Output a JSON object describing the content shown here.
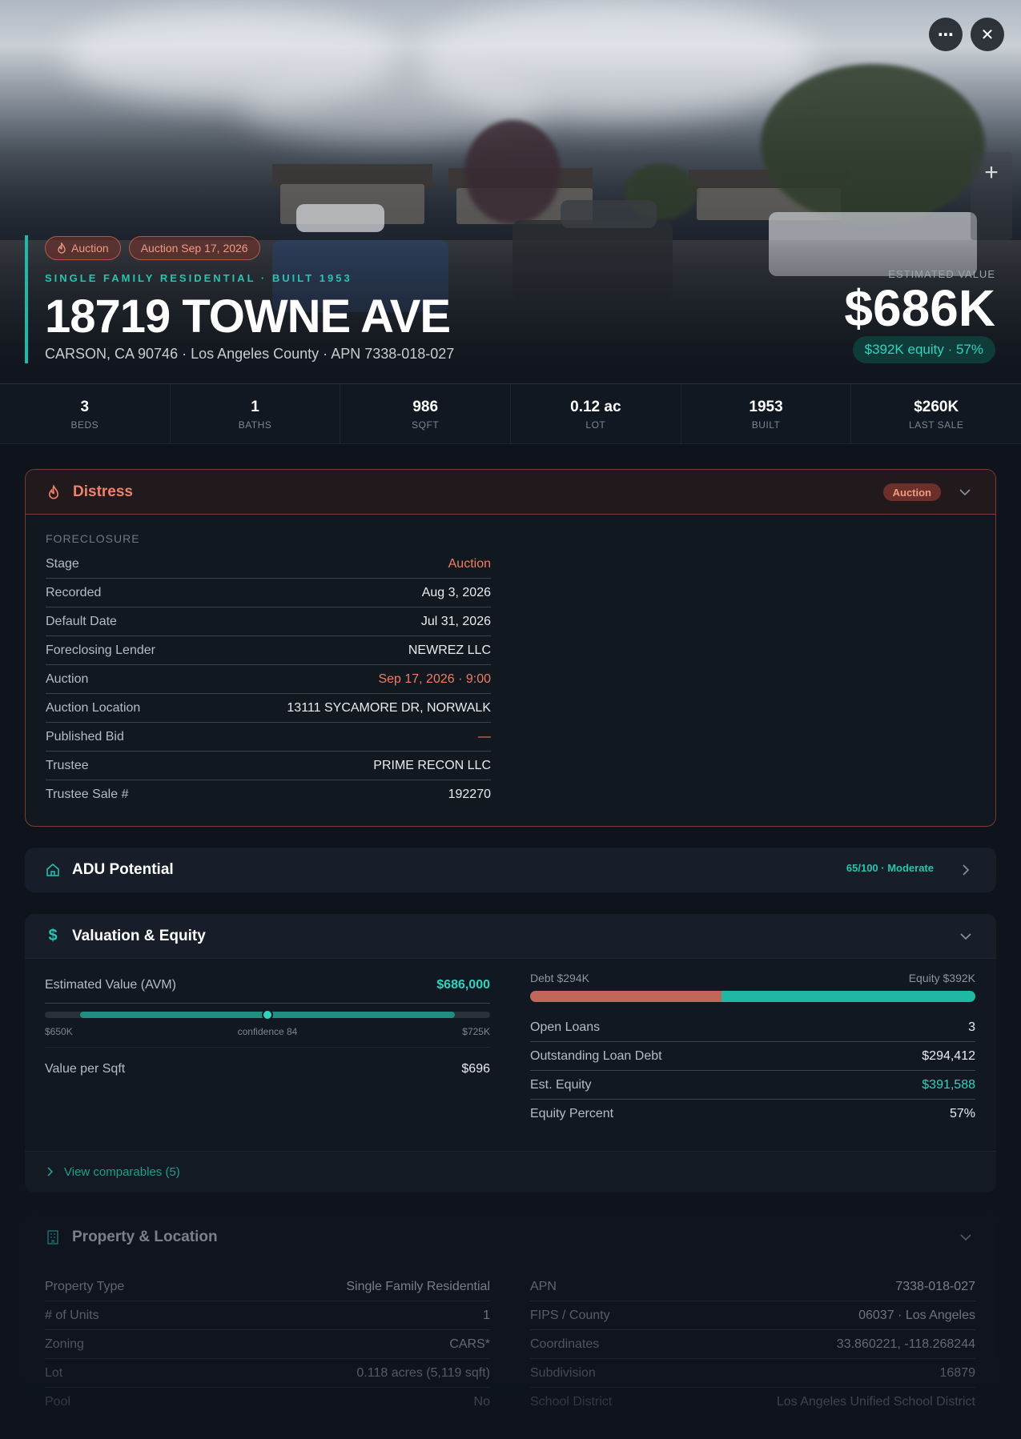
{
  "hero": {
    "tags": [
      "Auction",
      "Auction Sep 17, 2026"
    ],
    "kicker": "SINGLE FAMILY RESIDENTIAL · BUILT 1953",
    "address": "18719 TOWNE AVE",
    "subaddress": "CARSON, CA 90746 · Los Angeles County · APN 7338-018-027",
    "estimated_label": "ESTIMATED VALUE",
    "estimated_value": "$686K",
    "equity_pill": "$392K equity · 57%",
    "more_icon": "⋯",
    "close_icon": "✕",
    "zoom_icon": "+"
  },
  "stats": [
    {
      "value": "3",
      "label": "BEDS"
    },
    {
      "value": "1",
      "label": "BATHS"
    },
    {
      "value": "986",
      "label": "SQFT"
    },
    {
      "value": "0.12 ac",
      "label": "LOT"
    },
    {
      "value": "1953",
      "label": "BUILT"
    },
    {
      "value": "$260K",
      "label": "LAST SALE"
    }
  ],
  "distress": {
    "title": "Distress",
    "badge": "Auction",
    "section_label": "FORECLOSURE",
    "rows": [
      {
        "k": "Stage",
        "v": "Auction"
      },
      {
        "k": "Recorded",
        "v": "Aug 3, 2026"
      },
      {
        "k": "Default Date",
        "v": "Jul 31, 2026"
      },
      {
        "k": "Foreclosing Lender",
        "v": "NEWREZ LLC"
      },
      {
        "k": "Auction",
        "v": "Sep 17, 2026 · 9:00"
      },
      {
        "k": "Auction Location",
        "v": "13111 SYCAMORE DR, NORWALK"
      },
      {
        "k": "Published Bid",
        "v": "—"
      },
      {
        "k": "Trustee",
        "v": "PRIME RECON LLC"
      },
      {
        "k": "Trustee Sale #",
        "v": "192270"
      }
    ]
  },
  "adu": {
    "title": "ADU Potential",
    "score": "65/100 · Moderate"
  },
  "valuation": {
    "title": "Valuation & Equity",
    "avm_label": "Estimated Value (AVM)",
    "avm_value": "$686,000",
    "range_low": "$650K",
    "range_mid": "confidence 84",
    "range_high": "$725K",
    "range_position": 0.5,
    "vps_label": "Value per Sqft",
    "vps_value": "$696",
    "debt_label": "Debt $294K",
    "equity_label": "Equity $392K",
    "debt_fraction": 0.43,
    "rows": [
      {
        "k": "Open Loans",
        "v": "3"
      },
      {
        "k": "Outstanding Loan Debt",
        "v": "$294,412"
      },
      {
        "k": "Est. Equity",
        "v": "$391,588"
      },
      {
        "k": "Equity Percent",
        "v": "57%"
      }
    ],
    "comps_link": "View comparables (5)"
  },
  "property": {
    "title": "Property & Location",
    "left_rows": [
      {
        "k": "Property Type",
        "v": "Single Family Residential"
      },
      {
        "k": "# of Units",
        "v": "1"
      },
      {
        "k": "Zoning",
        "v": "CARS*"
      },
      {
        "k": "Lot",
        "v": "0.118 acres (5,119 sqft)"
      },
      {
        "k": "Pool",
        "v": "No"
      }
    ],
    "right_rows": [
      {
        "k": "APN",
        "v": "7338-018-027"
      },
      {
        "k": "FIPS / County",
        "v": "06037 · Los Angeles"
      },
      {
        "k": "Coordinates",
        "v": "33.860221, -118.268244"
      },
      {
        "k": "Subdivision",
        "v": "16879"
      },
      {
        "k": "School District",
        "v": "Los Angeles Unified School District"
      }
    ]
  },
  "colors": {
    "accent": "#20b8a6",
    "danger": "#ef7d63",
    "background": "#0e131c"
  }
}
